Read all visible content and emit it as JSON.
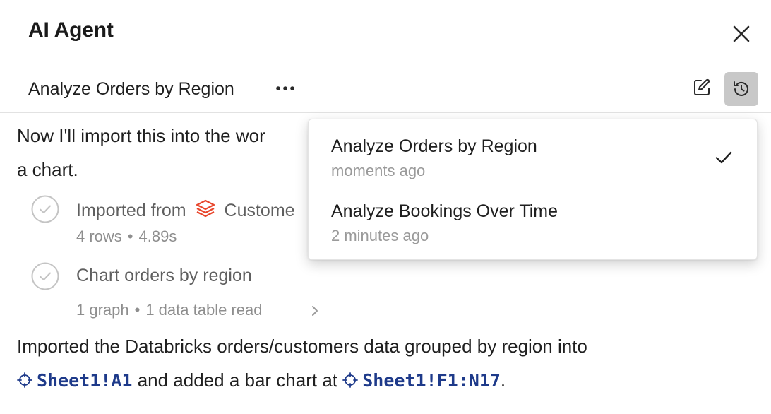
{
  "header": {
    "title": "AI Agent",
    "close_icon": "close-icon"
  },
  "conversation": {
    "title": "Analyze Orders by Region",
    "more_icon": "more-horizontal-icon",
    "edit_icon": "edit-icon",
    "history_icon": "history-icon"
  },
  "messages": {
    "intro_line1": "Now I'll import this into the wor",
    "intro_line2": "a chart.",
    "steps": [
      {
        "label_prefix": "Imported from",
        "source_name": "Custome",
        "source_icon": "databricks-icon",
        "meta_rows": "4 rows",
        "meta_time": "4.89s",
        "status_icon": "check-circle-icon"
      },
      {
        "label": "Chart orders by region",
        "meta_graph": "1 graph",
        "meta_table": "1 data table read",
        "status_icon": "check-circle-icon",
        "expand_icon": "chevron-right-icon"
      }
    ],
    "summary_line1": "Imported the Databricks orders/customers data grouped by region into",
    "summary_ref1": "Sheet1!A1",
    "summary_mid": " and added a bar chart at ",
    "summary_ref2": "Sheet1!F1:N17",
    "summary_end": "."
  },
  "history_dropdown": {
    "items": [
      {
        "title": "Analyze Orders by Region",
        "time": "moments ago",
        "selected": true
      },
      {
        "title": "Analyze Bookings Over Time",
        "time": "2 minutes ago",
        "selected": false
      }
    ]
  },
  "colors": {
    "ref_text": "#1e3a8a",
    "databricks_red": "#e8462c",
    "history_button_bg": "#c8c8c8"
  }
}
